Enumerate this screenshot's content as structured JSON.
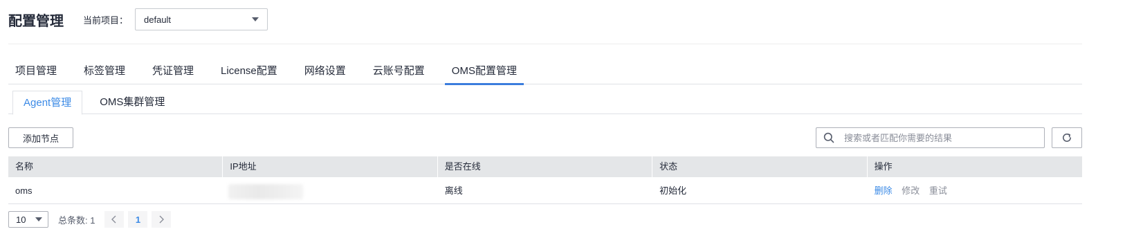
{
  "header": {
    "title": "配置管理",
    "project_label": "当前项目：",
    "project_value": "default"
  },
  "main_tabs": [
    {
      "label": "项目管理",
      "active": false
    },
    {
      "label": "标签管理",
      "active": false
    },
    {
      "label": "凭证管理",
      "active": false
    },
    {
      "label": "License配置",
      "active": false
    },
    {
      "label": "网络设置",
      "active": false
    },
    {
      "label": "云账号配置",
      "active": false
    },
    {
      "label": "OMS配置管理",
      "active": true
    }
  ],
  "sub_tabs": [
    {
      "label": "Agent管理",
      "active": true
    },
    {
      "label": "OMS集群管理",
      "active": false
    }
  ],
  "toolbar": {
    "add_label": "添加节点",
    "search_placeholder": "搜索或者匹配你需要的结果"
  },
  "table": {
    "columns": [
      "名称",
      "IP地址",
      "是否在线",
      "状态",
      "操作"
    ],
    "rows": [
      {
        "name": "oms",
        "online": "离线",
        "status": "初始化",
        "actions": [
          "删除",
          "修改",
          "重试"
        ]
      }
    ]
  },
  "pager": {
    "page_size": "10",
    "total_text": "总条数: 1",
    "current_page": "1"
  },
  "colors": {
    "accent": "#3b8ae6",
    "header_bg": "#e4e6e8",
    "border": "#adb0b8"
  }
}
